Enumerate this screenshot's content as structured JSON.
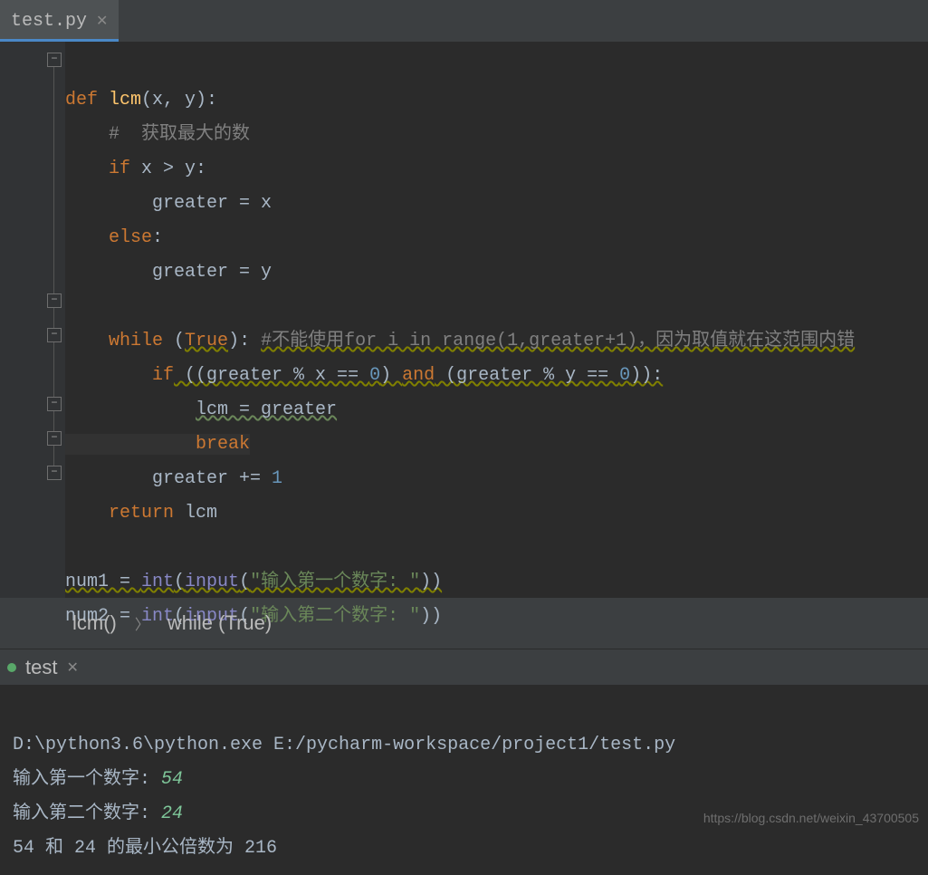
{
  "tab": {
    "filename": "test.py"
  },
  "code": {
    "kw_def": "def",
    "fn_name": "lcm",
    "params": "(x, y):",
    "c1": "#  获取最大的数",
    "kw_if": "if",
    "cond1": " x > y:",
    "assign1": "greater = x",
    "kw_else": "else",
    "colon": ":",
    "assign2": "greater = y",
    "kw_while": "while",
    "lp": " (",
    "true_kw": "True",
    "rp_colon": "): ",
    "c2": "#不能使用for i in range(1,greater+1)，因为取值就在这范围内错",
    "kw_if2": "if",
    "cond2a": " ((greater % x == ",
    "zero": "0",
    "cond2b": ") ",
    "kw_and": "and",
    "cond2c": " (greater % y == ",
    "cond2d": ")):",
    "assign3": "lcm = greater",
    "kw_break": "break",
    "inc": "greater += ",
    "one": "1",
    "kw_return": "return",
    "ret_val": " lcm",
    "n1a": "num1 = ",
    "int_fn": "int",
    "lp2": "(",
    "input_fn": "input",
    "lp3": "(",
    "s1": "\"输入第一个数字: \"",
    "rp2": "))",
    "n2a": "num2 = ",
    "s2": "\"输入第二个数字: \"",
    "rp3": "))"
  },
  "breadcrumb": {
    "item1": "lcm()",
    "item2": "while (True)"
  },
  "console": {
    "tab": "test",
    "line1": "D:\\python3.6\\python.exe E:/pycharm-workspace/project1/test.py",
    "p1": "输入第一个数字: ",
    "in1": "54",
    "p2": "输入第二个数字: ",
    "in2": "24",
    "result": "54 和 24 的最小公倍数为 216"
  },
  "watermark": "https://blog.csdn.net/weixin_43700505"
}
